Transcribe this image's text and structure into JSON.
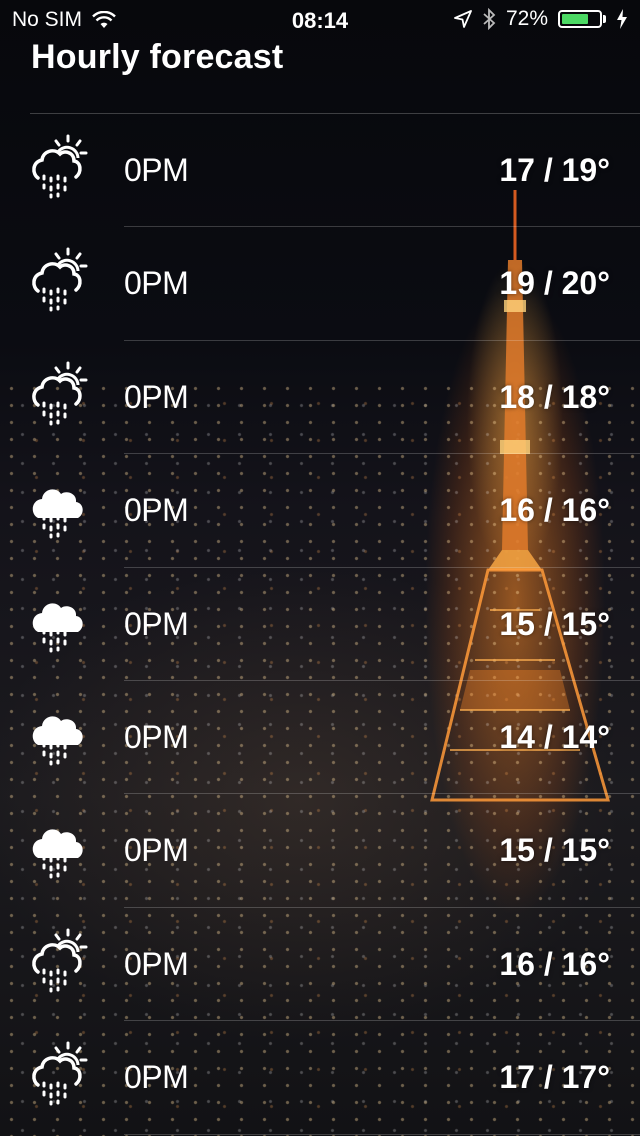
{
  "status_bar": {
    "carrier": "No SIM",
    "time": "08:14",
    "battery_percent": "72%",
    "battery_level": 0.72,
    "battery_color": "#4cd964",
    "icons": [
      "wifi-icon",
      "location-arrow-icon",
      "bluetooth-icon",
      "charging-bolt-icon"
    ]
  },
  "title": "Hourly forecast",
  "hours": [
    {
      "time": "0PM",
      "temp": "17 / 19°",
      "icon": "cloud-sun-rain-icon"
    },
    {
      "time": "0PM",
      "temp": "19 / 20°",
      "icon": "cloud-sun-rain-icon"
    },
    {
      "time": "0PM",
      "temp": "18 / 18°",
      "icon": "cloud-sun-rain-icon"
    },
    {
      "time": "0PM",
      "temp": "16 / 16°",
      "icon": "cloud-moon-rain-icon"
    },
    {
      "time": "0PM",
      "temp": "15 / 15°",
      "icon": "cloud-moon-rain-icon"
    },
    {
      "time": "0PM",
      "temp": "14 / 14°",
      "icon": "cloud-moon-rain-icon"
    },
    {
      "time": "0PM",
      "temp": "15 / 15°",
      "icon": "cloud-moon-rain-icon"
    },
    {
      "time": "0PM",
      "temp": "16 / 16°",
      "icon": "cloud-sun-rain-icon"
    },
    {
      "time": "0PM",
      "temp": "17 / 17°",
      "icon": "cloud-sun-rain-icon"
    }
  ]
}
